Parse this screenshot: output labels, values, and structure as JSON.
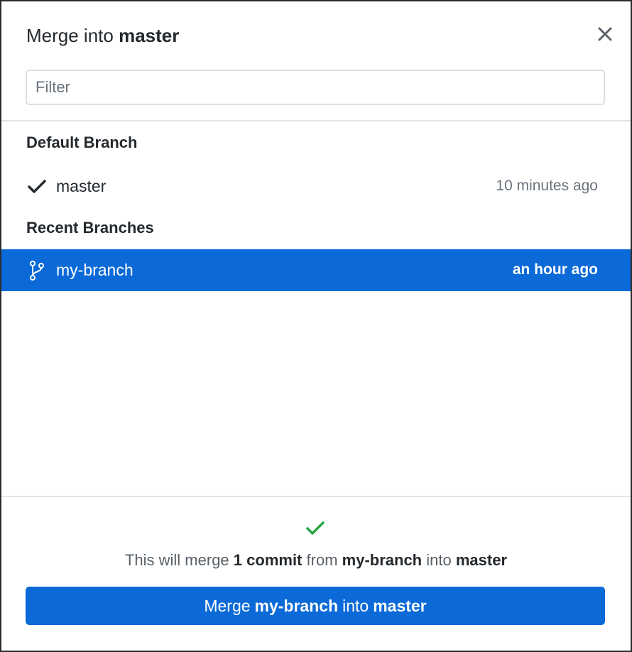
{
  "dialog": {
    "title_prefix": "Merge into",
    "title_branch": "master",
    "close_icon": "close-icon"
  },
  "filter": {
    "placeholder": "Filter",
    "value": ""
  },
  "sections": {
    "default_heading": "Default Branch",
    "recent_heading": "Recent Branches"
  },
  "branches": {
    "default": {
      "name": "master",
      "time": "10 minutes ago",
      "icon": "checkmark-icon"
    },
    "recent": [
      {
        "name": "my-branch",
        "time": "an hour ago",
        "icon": "git-branch-icon",
        "selected": true
      }
    ]
  },
  "summary": {
    "status_icon": "success-check-icon",
    "part1": "This will merge",
    "commit_count": "1 commit",
    "part2": "from",
    "source_branch": "my-branch",
    "part3": "into",
    "target_branch": "master"
  },
  "merge_button": {
    "prefix": "Merge",
    "source_branch": "my-branch",
    "middle": "into",
    "target_branch": "master"
  },
  "colors": {
    "accent": "#0b6ad7",
    "success": "#28a745",
    "text": "#24292e",
    "muted": "#6a737d"
  }
}
